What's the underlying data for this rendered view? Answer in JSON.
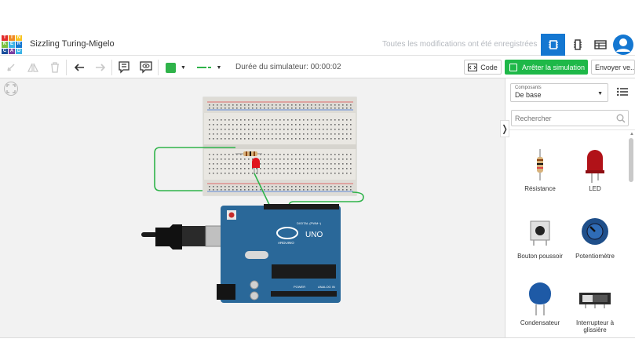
{
  "brand": {
    "logo_letters": [
      "TIN",
      "KER",
      "CAD"
    ],
    "logo_colors": [
      "#e22d2d",
      "#f08a24",
      "#f7c41f",
      "#7ac142",
      "#3bb3e6",
      "#1477d1",
      "#1b4f9c",
      "#7a3fa0",
      "#3bb3e6"
    ],
    "project_title": "Sizzling Turing-Migelo",
    "saved_status": "Toutes les modifications ont été enregistrées"
  },
  "toolbar": {
    "duration_label": "Durée du simulateur: 00:00:02",
    "code_label": "Code",
    "simulation_label": "Arrêter la simulation",
    "send_label": "Envoyer ve...",
    "fill_color": "#2fb34a",
    "line_color": "#2fb34a"
  },
  "panel": {
    "category_caption": "Composants",
    "category_value": "De base",
    "search_placeholder": "Rechercher",
    "components": [
      {
        "label": "Résistance",
        "icon": "resistor-icon"
      },
      {
        "label": "LED",
        "icon": "led-icon"
      },
      {
        "label": "Bouton poussoir",
        "icon": "pushbutton-icon"
      },
      {
        "label": "Potentiomètre",
        "icon": "potentiometer-icon"
      },
      {
        "label": "Condensateur",
        "icon": "capacitor-icon"
      },
      {
        "label": "Interrupteur à glissière",
        "icon": "slide-switch-icon"
      }
    ]
  },
  "board": {
    "model": "UNO",
    "maker": "ARDUINO",
    "digital_label": "DIGITAL (PWM~)",
    "power_label": "POWER",
    "analog_label": "ANALOG IN"
  },
  "colors": {
    "accent_blue": "#1477d1",
    "run_green": "#1eb848",
    "wire_green": "#2fb34a",
    "arduino_blue": "#2a6899"
  }
}
